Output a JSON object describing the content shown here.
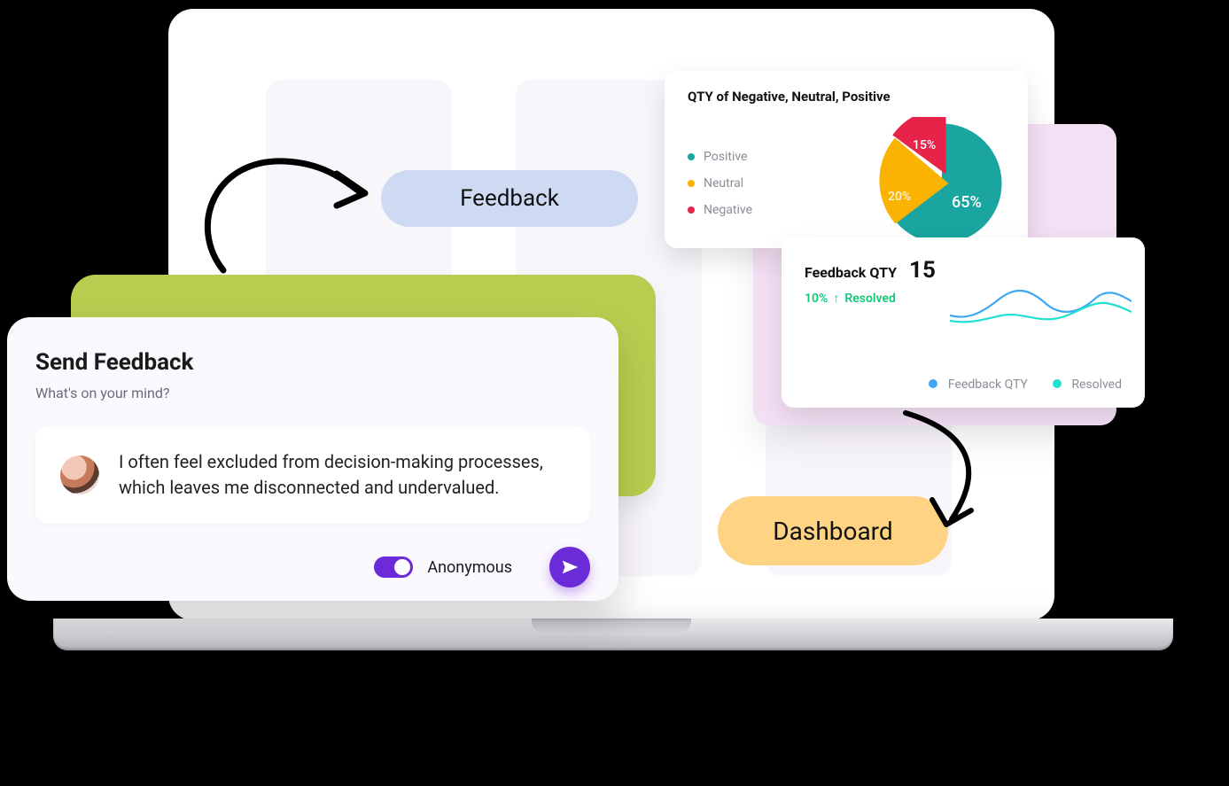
{
  "pills": {
    "feedback": "Feedback",
    "dashboard": "Dashboard"
  },
  "send_feedback": {
    "title": "Send Feedback",
    "subtitle": "What's on your mind?",
    "message": "I often feel excluded from decision-making processes, which leaves me disconnected and undervalued.",
    "anonymous_label": "Anonymous",
    "anonymous_on": true,
    "send_icon": "send-icon"
  },
  "pie_card": {
    "title": "QTY of Negative, Neutral, Positive",
    "legend": {
      "positive": "Positive",
      "neutral": "Neutral",
      "negative": "Negative"
    }
  },
  "line_card": {
    "title": "Feedback QTY",
    "value": "15",
    "resolved_pct": "10%",
    "resolved_label": "Resolved",
    "legend": {
      "feedback": "Feedback QTY",
      "resolved": "Resolved"
    }
  },
  "colors": {
    "positive": "#1aa5a0",
    "neutral": "#f9b300",
    "negative": "#e8234a",
    "accent_purple": "#6c2bd9",
    "accent_green": "#b8cd4f",
    "accent_blue_pill": "#cedaf2",
    "accent_yellow_pill": "#fed484",
    "accent_pink_panel": "#f4e0f5"
  },
  "chart_data": [
    {
      "type": "pie",
      "title": "QTY of Negative, Neutral, Positive",
      "series": [
        {
          "name": "Positive",
          "value": 65,
          "label": "65%",
          "color": "#1aa5a0"
        },
        {
          "name": "Neutral",
          "value": 20,
          "label": "20%",
          "color": "#f9b300"
        },
        {
          "name": "Negative",
          "value": 15,
          "label": "15%",
          "color": "#e8234a"
        }
      ]
    },
    {
      "type": "line",
      "title": "Feedback QTY",
      "x": [
        0,
        1,
        2,
        3,
        4,
        5,
        6,
        7,
        8,
        9
      ],
      "series": [
        {
          "name": "Feedback QTY",
          "color": "#3fa8f5",
          "values": [
            10,
            9,
            11,
            15,
            17,
            14,
            11,
            13,
            15,
            14
          ]
        },
        {
          "name": "Resolved",
          "color": "#20e0d0",
          "values": [
            9,
            8,
            9,
            11,
            10,
            9,
            9,
            12,
            13,
            12
          ]
        }
      ],
      "ylim": [
        5,
        20
      ],
      "summary_value": 15,
      "resolved_change_pct": 10,
      "resolved_label": "Resolved"
    }
  ]
}
